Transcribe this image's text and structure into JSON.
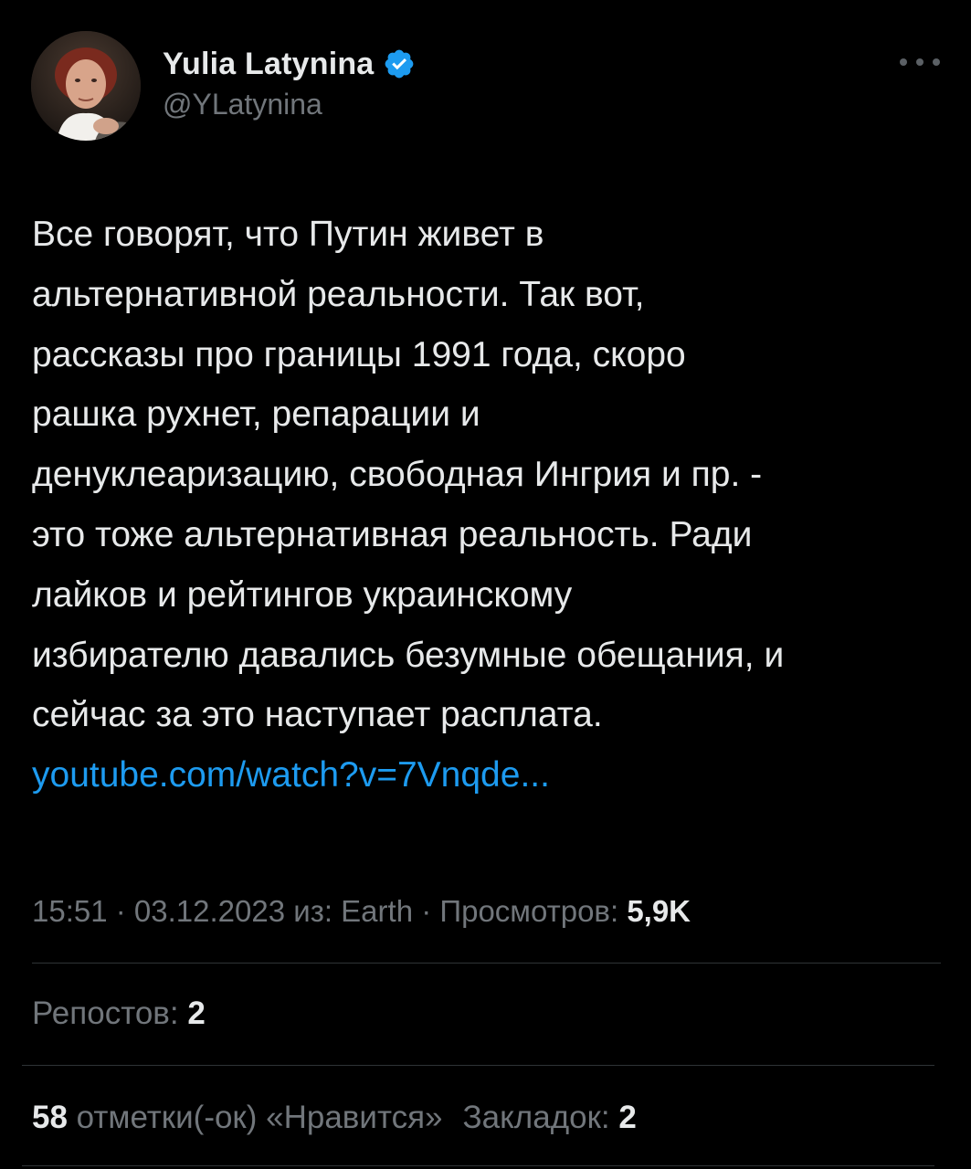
{
  "author": {
    "display_name": "Yulia Latynina",
    "handle": "@YLatynina",
    "verified_icon": "verified-badge-icon",
    "accent_color": "#1d9bf0"
  },
  "menu": {
    "icon": "more-options-icon"
  },
  "tweet": {
    "text": "Все говорят, что Путин живет в\nальтернативной реальности. Так вот,\nрассказы про границы 1991 года, скоро\nрашка рухнет, репарации и\nденуклеаризацию, свободная Ингрия и пр. -\nэто тоже альтернативная реальность. Ради\nлайков и рейтингов украинскому\nизбирателю давались безумные обещания, и\nсейчас за это наступает расплата.",
    "link_text": "youtube.com/watch?v=7Vnqde..."
  },
  "meta": {
    "time": "15:51",
    "separator": " · ",
    "date": "03.12.2023",
    "source": "из: Earth",
    "views_label": "Просмотров:",
    "views_count": "5,9K"
  },
  "stats": {
    "reposts_label": "Репостов:",
    "reposts_count": "2",
    "likes_count": "58",
    "likes_label": "отметки(-ок) «Нравится»",
    "bookmarks_label": "Закладок:",
    "bookmarks_count": "2"
  }
}
